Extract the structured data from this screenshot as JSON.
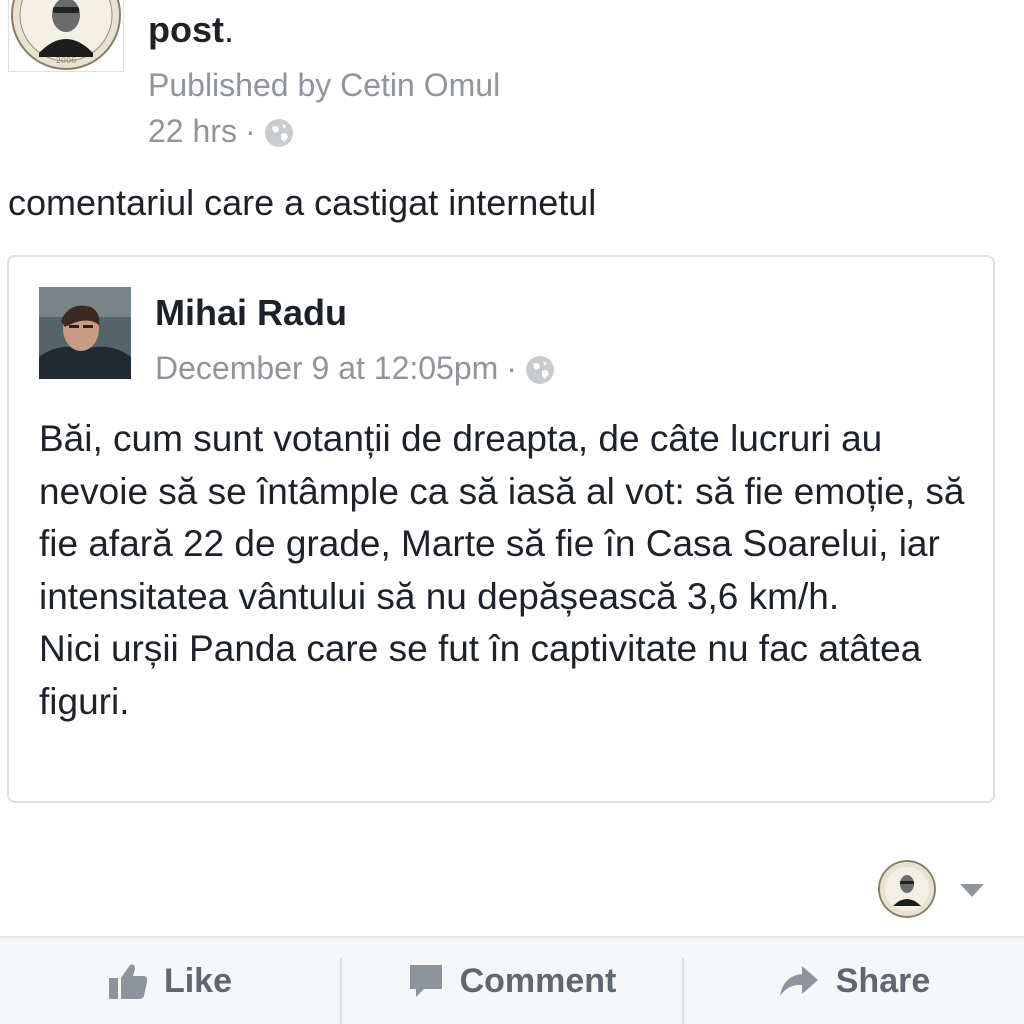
{
  "header": {
    "title": "post",
    "title_suffix": ".",
    "published_by": "Published by Cetin Omul",
    "time": "22 hrs",
    "separator": "·",
    "privacy_icon": "globe-icon"
  },
  "post": {
    "caption": "comentariul care a castigat internetul"
  },
  "shared_card": {
    "author": "Mihai Radu",
    "date": "December 9 at 12:05pm",
    "separator": "·",
    "privacy_icon": "globe-icon",
    "paragraphs": [
      "Băi, cum sunt votanții de dreapta, de câte lucruri au nevoie să se întâmple ca să iasă al vot: să fie emoție, să fie afară 22 de grade, Marte să fie în Casa Soarelui, iar intensitatea vântului să nu depășească 3,6 km/h.",
      "Nici urșii Panda care se fut în captivitate nu fac atâtea figuri."
    ]
  },
  "actions": [
    {
      "label": "Like",
      "icon": "thumbs-up-icon"
    },
    {
      "label": "Comment",
      "icon": "comment-icon"
    },
    {
      "label": "Share",
      "icon": "share-arrow-icon"
    }
  ],
  "colors": {
    "text": "#1d2129",
    "muted": "#90949c",
    "action": "#606770",
    "border": "#dddfe2",
    "bar_bg": "#f6f7f9"
  }
}
